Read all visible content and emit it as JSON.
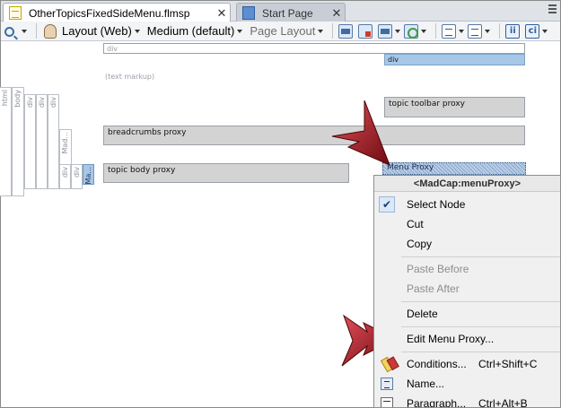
{
  "tabs": [
    {
      "label": "OtherTopicsFixedSideMenu.flmsp",
      "active": true,
      "icon": "document-icon"
    },
    {
      "label": "Start Page",
      "active": false,
      "icon": "start-page-icon"
    }
  ],
  "toolbar": {
    "layout": "Layout (Web)",
    "medium": "Medium (default)",
    "page_layout": "Page Layout"
  },
  "canvas": {
    "div_top": "div",
    "div_right": "div",
    "text_markup": "(text markup)",
    "topic_toolbar": "topic toolbar proxy",
    "breadcrumbs": "breadcrumbs proxy",
    "topic_body": "topic body proxy",
    "menu_proxy": "Menu Proxy",
    "structure_bars": [
      "html",
      "body",
      "div",
      "div",
      "div",
      "Mad...",
      "div",
      "div",
      "Ma..."
    ]
  },
  "context_menu": {
    "title": "<MadCap:menuProxy>",
    "items": [
      {
        "label": "Select Node",
        "checked": true,
        "disabled": false
      },
      {
        "label": "Cut",
        "disabled": false
      },
      {
        "label": "Copy",
        "disabled": false
      },
      {
        "label": "Paste Before",
        "disabled": true
      },
      {
        "label": "Paste After",
        "disabled": true
      },
      {
        "label": "Delete",
        "disabled": false
      },
      {
        "label": "Edit Menu Proxy...",
        "disabled": false
      },
      {
        "label": "Conditions...",
        "shortcut": "Ctrl+Shift+C",
        "icon": "conditions-icon"
      },
      {
        "label": "Name...",
        "icon": "name-icon"
      },
      {
        "label": "Paragraph...",
        "shortcut": "Ctrl+Alt+B",
        "icon": "paragraph-icon"
      }
    ]
  },
  "colors": {
    "arrow": "#b0161c",
    "selection": "#a7c7e6",
    "proxy_gray": "#d3d3d3"
  }
}
